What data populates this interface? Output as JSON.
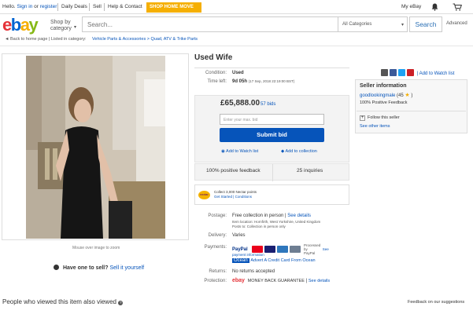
{
  "topbar": {
    "greeting_prefix": "Hello.",
    "sign_in": "Sign in",
    "or": "or",
    "register": "register",
    "daily_deals": "Daily Deals",
    "sell": "Sell",
    "help": "Help & Contact",
    "promo": "SHOP HOME MOVE",
    "my_ebay": "My eBay"
  },
  "header": {
    "logo": [
      "e",
      "b",
      "a",
      "y"
    ],
    "shop_by": "Shop by",
    "category": "category",
    "search_placeholder": "Search...",
    "all_categories": "All Categories",
    "search_button": "Search",
    "advanced": "Advanced"
  },
  "breadcrumb": {
    "back": "Back to home page",
    "listed_in": "| Listed in category:",
    "path": "Vehicle Parts & Accessories > Quad, ATV & Trike Parts"
  },
  "image": {
    "hint": "Mouse over image to zoom"
  },
  "sell_prompt": {
    "text": "Have one to sell?",
    "link": "Sell it yourself"
  },
  "listing": {
    "title": "Used Wife",
    "condition_label": "Condition:",
    "condition_value": "Used",
    "time_left_label": "Time left:",
    "time_left_value": "9d 05h",
    "time_left_date": "(17 Sep, 2018   22:19:00 BST)",
    "price": "£65,888.00",
    "bids": "57 bids",
    "max_bid_placeholder": "Enter your max. bid",
    "submit_bid": "Submit bid",
    "watch": "Add to Watch list",
    "collection": "Add to collection",
    "positive_feedback": "100% positive feedback",
    "inquiries": "25 inquiries",
    "nectar_line1": "Collect 3,000 Nectar points",
    "nectar_line2": "Get Started | Conditions",
    "nectar_badge": "nectar",
    "postage_label": "Postage:",
    "postage_value": "Free collection in person",
    "see_details": "See details",
    "item_location": "Item location:  Hornfirth, West Yorkshire, United Kingdom",
    "posts_to": "Posts to:  Collection in person only",
    "delivery_label": "Delivery:",
    "delivery_value": "Varies",
    "payments_label": "Payments:",
    "paypal": "PayPal",
    "processed_by": "Processed by PayPal",
    "see": "See",
    "payment_info": "payment information",
    "ocean_logo": "Ocean",
    "ocean_text": "Advert  A Credit Card From Ocean",
    "returns_label": "Returns:",
    "returns_value": "No returns accepted",
    "protection_label": "Protection:",
    "protection_logo": "ebay",
    "money_back": "MONEY BACK GUARANTEE",
    "share_link": "| Add to Watch list"
  },
  "seller": {
    "title": "Seller information",
    "name": "goodlookingmale",
    "score": "(45",
    "score_close": ")",
    "feedback": "100% Positive Feedback",
    "follow": "Follow this seller",
    "other_items": "See other items"
  },
  "footer": {
    "viewed": "People who viewed this item also viewed",
    "feedback": "Feedback on our suggestions"
  },
  "colors": {
    "ebay_red": "#e53238",
    "ebay_blue": "#0064d2",
    "ebay_yellow": "#f5af02",
    "ebay_green": "#86b817",
    "link": "#0654ba"
  }
}
